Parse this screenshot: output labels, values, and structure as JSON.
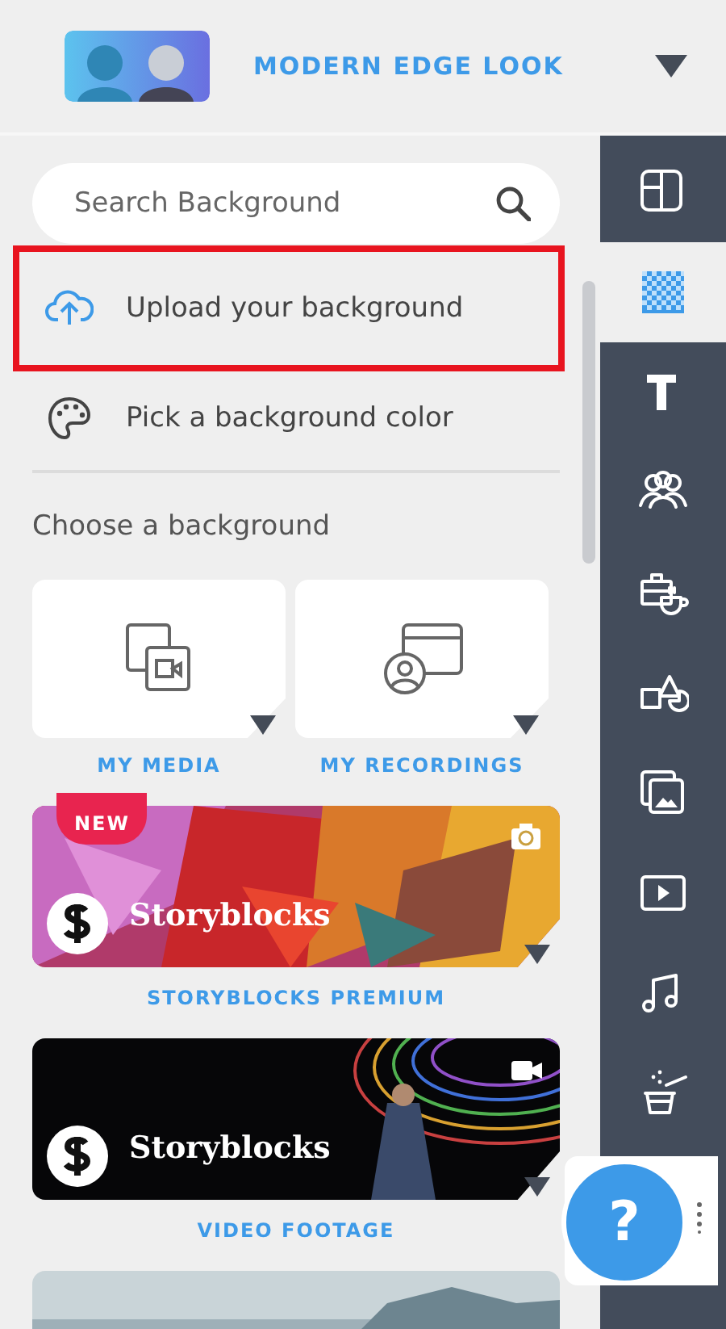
{
  "header": {
    "title": "MODERN EDGE LOOK"
  },
  "search": {
    "placeholder": "Search Background"
  },
  "actions": [
    {
      "kind": "upload",
      "label": "Upload your background",
      "highlighted": true
    },
    {
      "kind": "palette",
      "label": "Pick a background color",
      "highlighted": false
    }
  ],
  "section_heading": "Choose a background",
  "tiles": [
    {
      "kind": "media",
      "label": "MY MEDIA"
    },
    {
      "kind": "recordings",
      "label": "MY RECORDINGS"
    }
  ],
  "cards": [
    {
      "badge": "NEW",
      "brand": "Storyblocks",
      "label": "STORYBLOCKS PREMIUM"
    },
    {
      "kind": "video",
      "brand": "Storyblocks",
      "label": "VIDEO FOOTAGE"
    },
    {
      "kind": "landscape"
    }
  ],
  "toolbar": [
    {
      "kind": "layout",
      "selected": false
    },
    {
      "kind": "background",
      "selected": true
    },
    {
      "kind": "text",
      "selected": false
    },
    {
      "kind": "people",
      "selected": false
    },
    {
      "kind": "props",
      "selected": false
    },
    {
      "kind": "shapes",
      "selected": false
    },
    {
      "kind": "images",
      "selected": false
    },
    {
      "kind": "video",
      "selected": false
    },
    {
      "kind": "music",
      "selected": false
    },
    {
      "kind": "effects",
      "selected": false
    }
  ],
  "help": {
    "label": "?"
  }
}
